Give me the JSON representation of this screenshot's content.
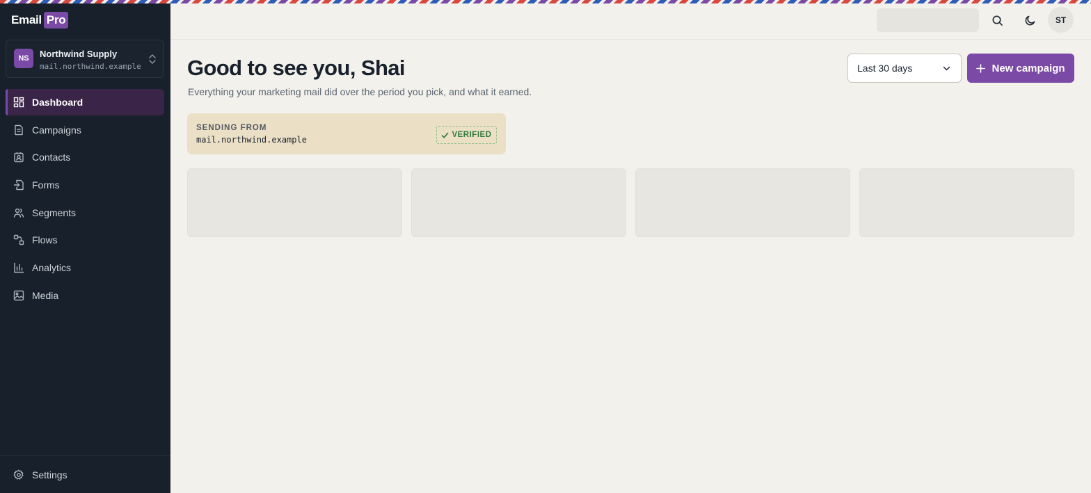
{
  "brand": {
    "name": "Email",
    "badge": "Pro"
  },
  "workspace": {
    "initials": "NS",
    "name": "Northwind Supply",
    "domain": "mail.northwind.example"
  },
  "nav": {
    "items": [
      {
        "label": "Dashboard",
        "icon": "grid-icon",
        "active": true
      },
      {
        "label": "Campaigns",
        "icon": "document-icon",
        "active": false
      },
      {
        "label": "Contacts",
        "icon": "contact-card-icon",
        "active": false
      },
      {
        "label": "Forms",
        "icon": "form-enter-icon",
        "active": false
      },
      {
        "label": "Segments",
        "icon": "users-icon",
        "active": false
      },
      {
        "label": "Flows",
        "icon": "flow-icon",
        "active": false
      },
      {
        "label": "Analytics",
        "icon": "bar-chart-icon",
        "active": false
      },
      {
        "label": "Media",
        "icon": "image-icon",
        "active": false
      }
    ],
    "settings_label": "Settings"
  },
  "topbar": {
    "user_initials": "ST",
    "icons": [
      "search-icon",
      "moon-icon"
    ]
  },
  "header": {
    "greeting": "Good to see you, Shai",
    "subtitle": "Everything your marketing mail did over the period you pick, and what it earned.",
    "range_selected": "Last 30 days",
    "new_campaign_label": "New campaign"
  },
  "sending": {
    "label": "SENDING FROM",
    "domain": "mail.northwind.example",
    "status": "VERIFIED"
  },
  "colors": {
    "accent": "#7b49a6",
    "sidebar_bg": "#17202b",
    "page_bg": "#f2f1ec",
    "verified": "#2f7a3a"
  }
}
